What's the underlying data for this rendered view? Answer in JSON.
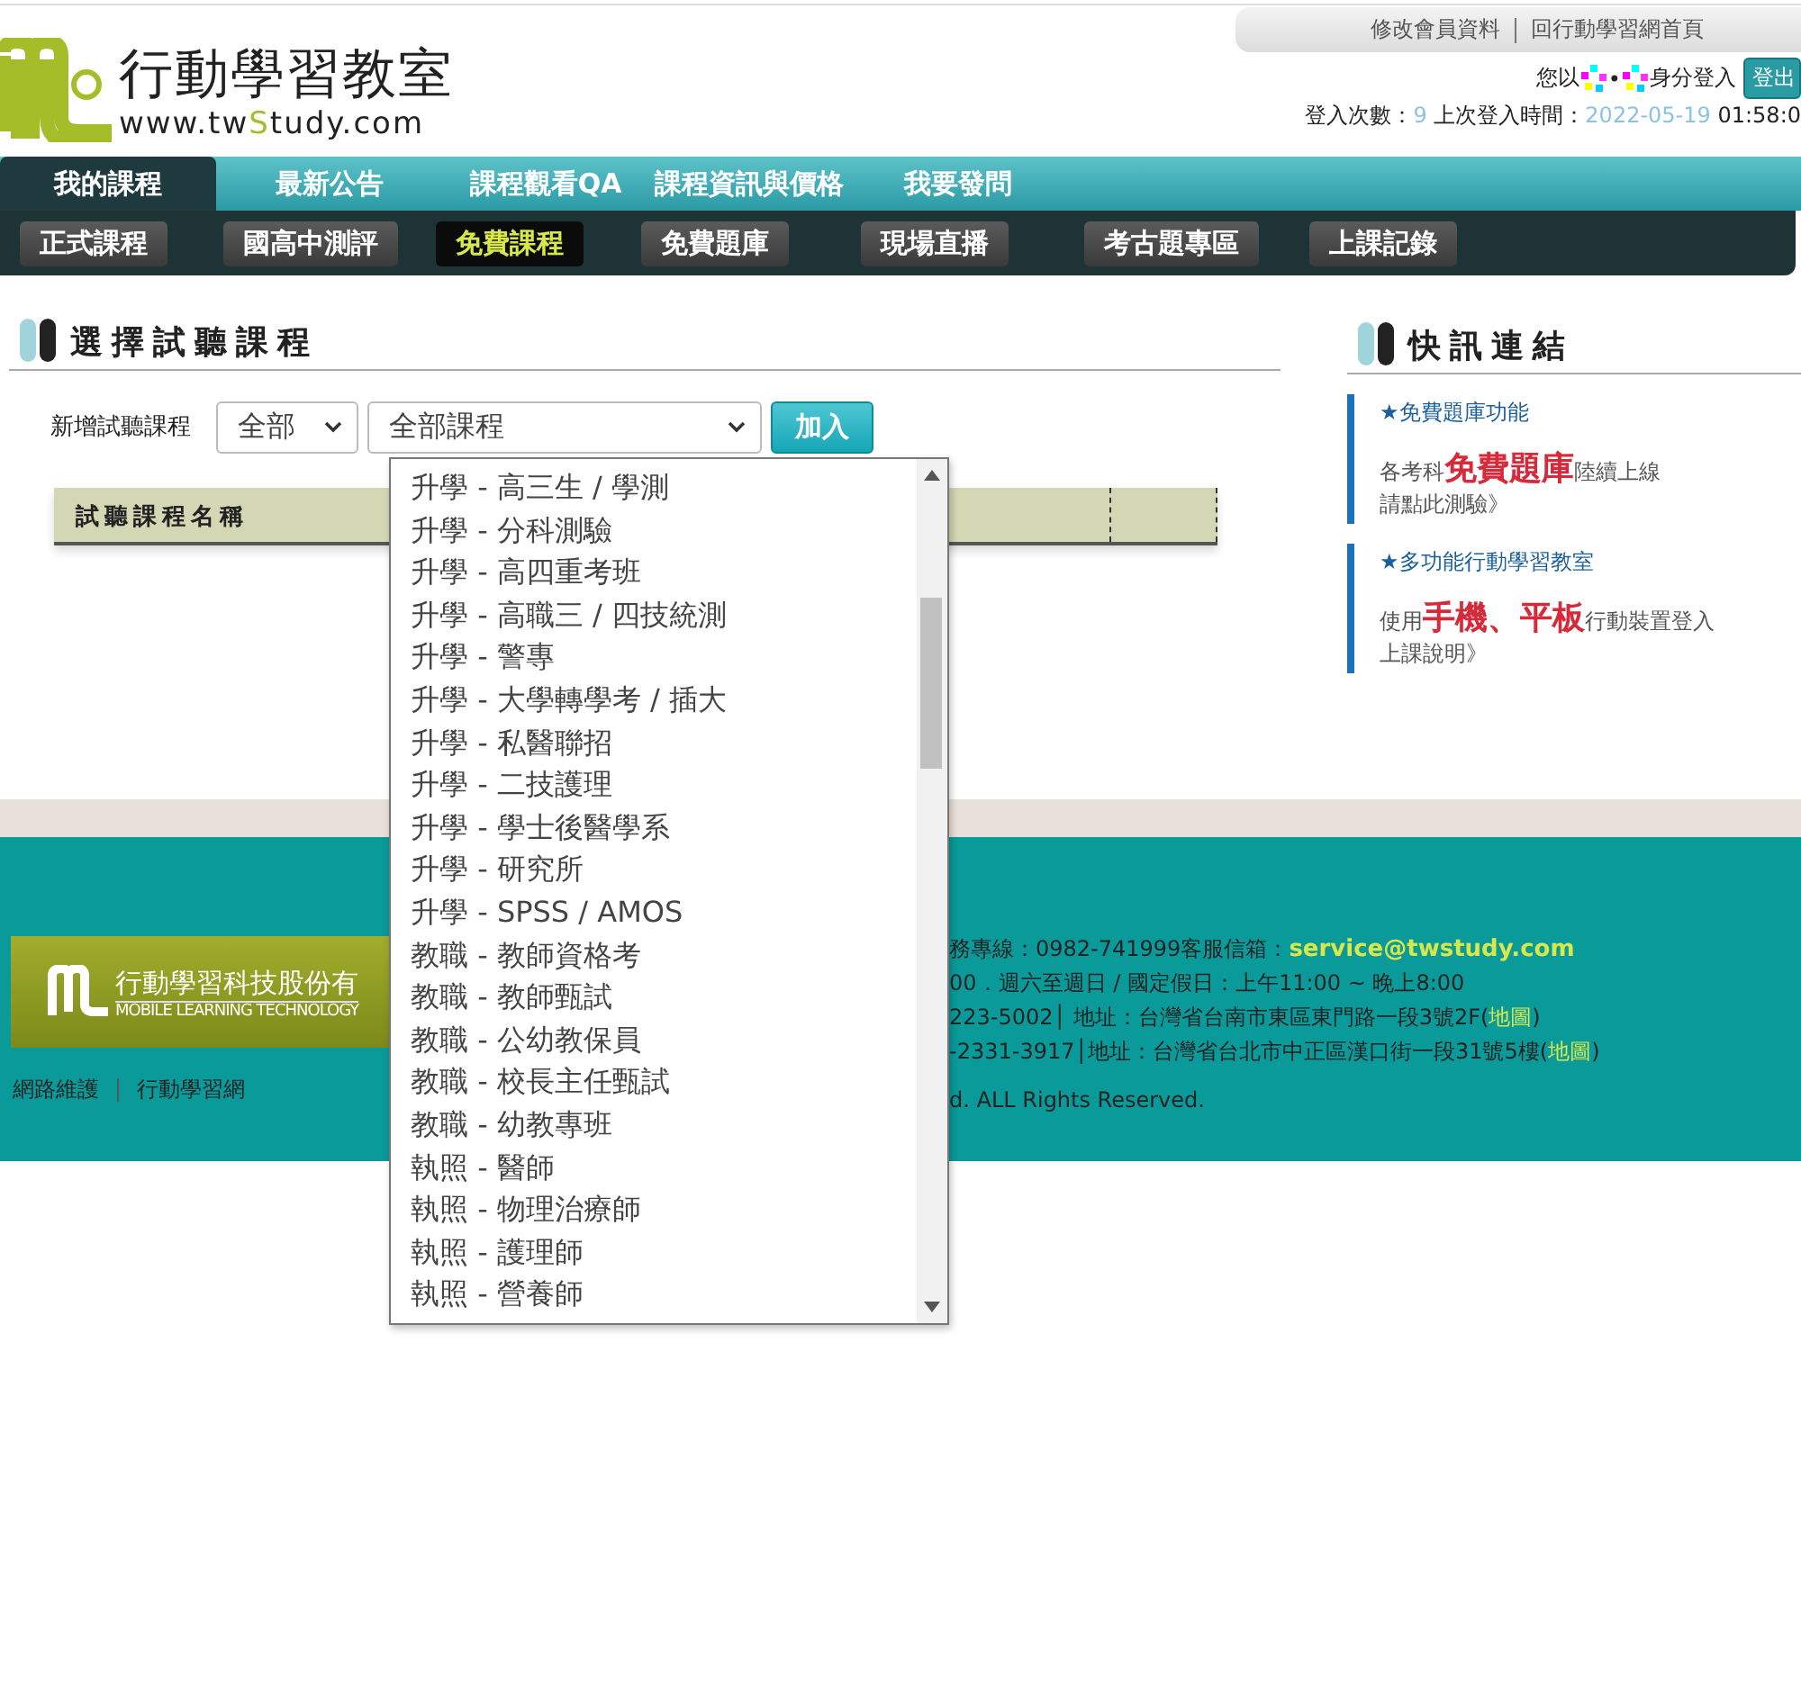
{
  "header": {
    "account_links": [
      "修改會員資料",
      "回行動學習網首頁"
    ],
    "logo": {
      "title": "行動學習教室",
      "url_parts": [
        "www.tw",
        "S",
        "tudy.com"
      ]
    },
    "login": {
      "prefix": "您以",
      "separator": "•",
      "suffix": "身分登入",
      "logout": "登出"
    },
    "login_info": {
      "count_label": "登入次數：",
      "count": "9",
      "last_label": "上次登入時間：",
      "last_date": "2022-05-19",
      "last_time": "01:58:0"
    }
  },
  "nav": [
    {
      "label": "我的課程",
      "selected": true
    },
    {
      "label": "最新公告",
      "selected": false
    },
    {
      "label": "課程觀看QA",
      "selected": false
    },
    {
      "label": "課程資訊與價格",
      "selected": false
    },
    {
      "label": "我要發問",
      "selected": false
    }
  ],
  "subnav": [
    {
      "label": "正式課程",
      "selected": false
    },
    {
      "label": "國高中測評",
      "selected": false
    },
    {
      "label": "免費課程",
      "selected": true
    },
    {
      "label": "免費題庫",
      "selected": false
    },
    {
      "label": "現場直播",
      "selected": false
    },
    {
      "label": "考古題專區",
      "selected": false
    },
    {
      "label": "上課記錄",
      "selected": false
    }
  ],
  "main": {
    "title": "選擇試聽課程",
    "form": {
      "label": "新增試聽課程",
      "category": "全部",
      "course": "全部課程",
      "button": "加入"
    },
    "table": {
      "columns": [
        "試聽課程名稱"
      ]
    },
    "dropdown": {
      "options": [
        "升學 - 高三生 / 學測",
        "升學 - 分科測驗",
        "升學 - 高四重考班",
        "升學 - 高職三 / 四技統測",
        "升學 - 警專",
        "升學 - 大學轉學考 / 插大",
        "升學 - 私醫聯招",
        "升學 - 二技護理",
        "升學 - 學士後醫學系",
        "升學 - 研究所",
        "升學 - SPSS / AMOS",
        "教職 - 教師資格考",
        "教職 - 教師甄試",
        "教職 - 公幼教保員",
        "教職 - 校長主任甄試",
        "教職 - 幼教專班",
        "執照 - 醫師",
        "執照 - 物理治療師",
        "執照 - 護理師",
        "執照 - 營養師"
      ]
    }
  },
  "sidebar": {
    "title": "快訊連結",
    "items": [
      {
        "heading": "★免費題庫功能",
        "text": "各考科**免費題庫**陸續上線",
        "link": "請點此測驗》"
      },
      {
        "heading": "★多功能行動學習教室",
        "text": "使用**手機、平板**行動裝置登入",
        "link": "上課說明》"
      }
    ]
  },
  "footer": {
    "company": "行動學習科技股份有",
    "company_en": "MOBILE LEARNING TECHNOLOGY",
    "links": [
      "網路維護",
      "行動學習網"
    ],
    "contact": {
      "phone_text": "務專線：0982-741999客服信箱：",
      "email": "service@twstudy.com"
    },
    "hours": "00．週六至週日 / 國定假日：上午11:00 ~ 晚上8:00",
    "offices": [
      {
        "text": "223-5002│ 地址：台灣省台南市東區東門路一段3號2F(",
        "link": "地圖",
        "after": ")"
      },
      {
        "text": "-2331-3917│地址：台灣省台北市中正區漢口街一段31號5樓(",
        "link": "地圖",
        "after": ")"
      }
    ],
    "copyright": "d. ALL Rights Reserved."
  }
}
